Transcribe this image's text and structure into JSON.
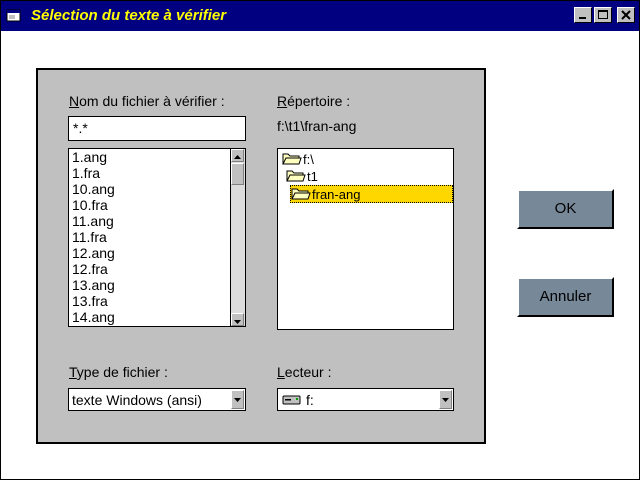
{
  "window": {
    "title": "Sélection du texte à vérifier"
  },
  "labels": {
    "filename_prefix": "N",
    "filename_rest": "om du fichier à vérifier :",
    "directory_prefix": "R",
    "directory_rest": "épertoire :",
    "filetype_prefix": "T",
    "filetype_rest": "ype de fichier :",
    "drive_prefix": "L",
    "drive_rest": "ecteur :"
  },
  "filename_input": {
    "value": "*.*"
  },
  "current_directory": "f:\\t1\\fran-ang",
  "file_list": [
    "1.ang",
    "1.fra",
    "10.ang",
    "10.fra",
    "11.ang",
    "11.fra",
    "12.ang",
    "12.fra",
    "13.ang",
    "13.fra",
    "14.ang"
  ],
  "directory_tree": {
    "items": [
      "f:\\",
      "t1",
      "fran-ang"
    ],
    "selected": "fran-ang"
  },
  "filetype_select": {
    "value": "texte Windows (ansi)"
  },
  "drive_select": {
    "value": "f:"
  },
  "buttons": {
    "ok": "OK",
    "cancel": "Annuler"
  },
  "colors": {
    "titlebar": "#000080",
    "title_text": "#ffff00",
    "panel": "#c0c0c0",
    "button": "#778899",
    "selection": "#ffd700"
  },
  "icons": [
    "window-icon",
    "minimize-icon",
    "maximize-icon",
    "close-icon",
    "folder-open-icon",
    "drive-icon",
    "arrow-up-icon",
    "arrow-down-icon"
  ]
}
